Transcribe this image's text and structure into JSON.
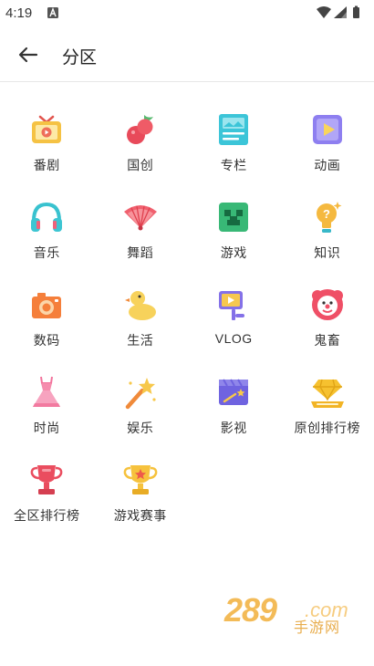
{
  "status_bar": {
    "time": "4:19"
  },
  "header": {
    "title": "分区"
  },
  "categories": [
    {
      "label": "番剧",
      "icon": "tv-icon"
    },
    {
      "label": "国创",
      "icon": "cherry-icon"
    },
    {
      "label": "专栏",
      "icon": "article-icon"
    },
    {
      "label": "动画",
      "icon": "animation-play-icon"
    },
    {
      "label": "音乐",
      "icon": "headphones-icon"
    },
    {
      "label": "舞蹈",
      "icon": "fan-icon"
    },
    {
      "label": "游戏",
      "icon": "game-face-icon"
    },
    {
      "label": "知识",
      "icon": "lightbulb-icon"
    },
    {
      "label": "数码",
      "icon": "camera-icon"
    },
    {
      "label": "生活",
      "icon": "duck-icon"
    },
    {
      "label": "VLOG",
      "icon": "vlog-camera-icon"
    },
    {
      "label": "鬼畜",
      "icon": "clown-icon"
    },
    {
      "label": "时尚",
      "icon": "dress-icon"
    },
    {
      "label": "娱乐",
      "icon": "magic-wand-icon"
    },
    {
      "label": "影视",
      "icon": "clapperboard-icon"
    },
    {
      "label": "原创排行榜",
      "icon": "diamond-crown-icon"
    },
    {
      "label": "全区排行榜",
      "icon": "trophy-icon"
    },
    {
      "label": "游戏赛事",
      "icon": "star-trophy-icon"
    }
  ],
  "watermark": {
    "main": "289",
    "domain": ".com",
    "sub": "手游网"
  },
  "colors": {
    "text": "#333333",
    "divider": "#e6e6e6"
  }
}
